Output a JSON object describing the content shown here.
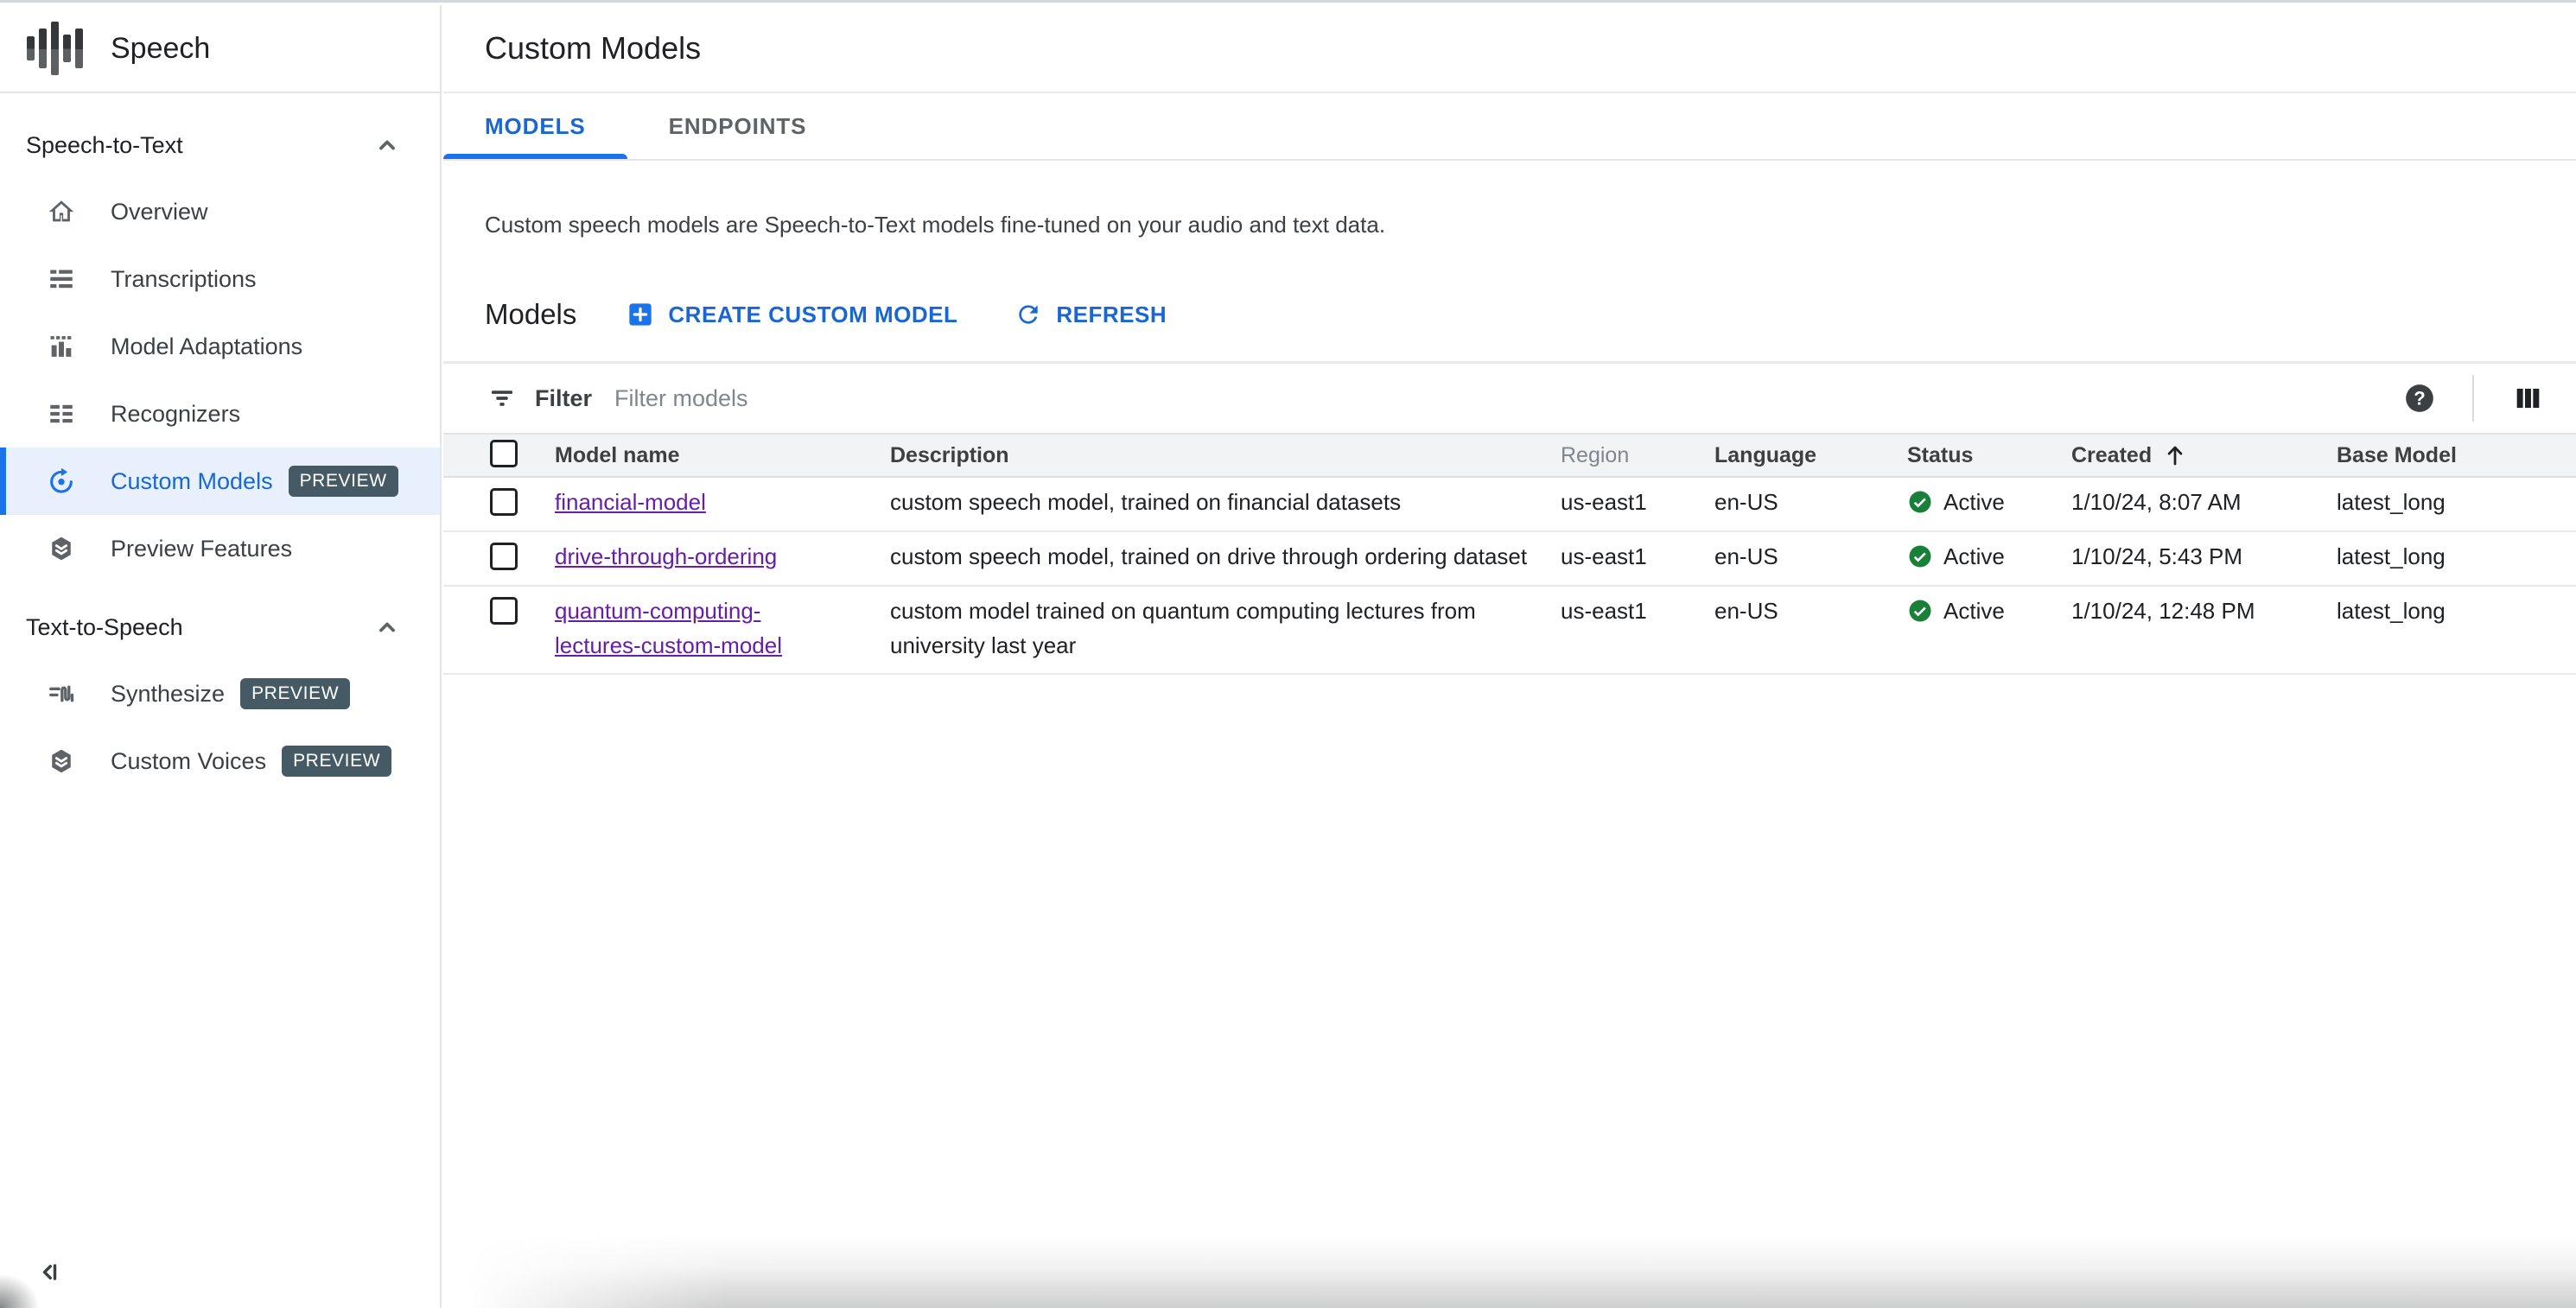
{
  "app": {
    "title": "Speech"
  },
  "sidebar": {
    "sections": [
      {
        "label": "Speech-to-Text",
        "items": [
          {
            "label": "Overview",
            "icon": "home-icon"
          },
          {
            "label": "Transcriptions",
            "icon": "transcriptions-icon"
          },
          {
            "label": "Model Adaptations",
            "icon": "bar-chart-icon"
          },
          {
            "label": "Recognizers",
            "icon": "recognizers-icon"
          },
          {
            "label": "Custom Models",
            "icon": "custom-models-icon",
            "badge": "PREVIEW",
            "selected": true
          },
          {
            "label": "Preview Features",
            "icon": "layers-hexagon-icon"
          }
        ]
      },
      {
        "label": "Text-to-Speech",
        "items": [
          {
            "label": "Synthesize",
            "icon": "synthesize-waveform-icon",
            "badge": "PREVIEW"
          },
          {
            "label": "Custom Voices",
            "icon": "layers-hexagon-icon",
            "badge": "PREVIEW"
          }
        ]
      }
    ]
  },
  "header": {
    "title": "Custom Models",
    "tabs": [
      {
        "label": "MODELS",
        "active": true
      },
      {
        "label": "ENDPOINTS",
        "active": false
      }
    ]
  },
  "main": {
    "description": "Custom speech models are Speech-to-Text models fine-tuned on your audio and text data.",
    "section_title": "Models",
    "actions": {
      "create": "CREATE CUSTOM MODEL",
      "refresh": "REFRESH"
    },
    "filter": {
      "label": "Filter",
      "placeholder": "Filter models"
    },
    "table": {
      "columns": [
        "Model name",
        "Description",
        "Region",
        "Language",
        "Status",
        "Created",
        "Base Model"
      ],
      "sort": {
        "column": "Created",
        "direction": "ascending"
      },
      "rows": [
        {
          "name": "financial-model",
          "description": "custom speech model, trained on financial datasets",
          "region": "us-east1",
          "language": "en-US",
          "status": "Active",
          "created": "1/10/24, 8:07 AM",
          "base_model": "latest_long"
        },
        {
          "name": "drive-through-ordering",
          "description": "custom speech model, trained on drive through ordering dataset",
          "region": "us-east1",
          "language": "en-US",
          "status": "Active",
          "created": "1/10/24, 5:43 PM",
          "base_model": "latest_long"
        },
        {
          "name": "quantum-computing-lectures-custom-model",
          "description": "custom model trained on quantum computing lectures from university last year",
          "region": "us-east1",
          "language": "en-US",
          "status": "Active",
          "created": "1/10/24, 12:48 PM",
          "base_model": "latest_long"
        }
      ]
    }
  },
  "colors": {
    "accent_blue": "#1a73e8",
    "active_text_blue": "#1967d2",
    "selected_item_bg": "#e8f0fe",
    "visited_link_purple": "#681da8",
    "status_active_green": "#188038",
    "preview_badge_bg": "#455a64"
  }
}
